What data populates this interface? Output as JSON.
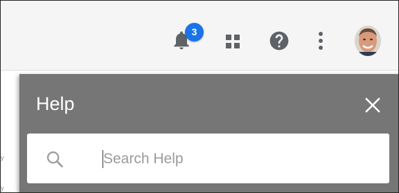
{
  "header": {
    "notifications": {
      "icon": "bell-icon",
      "count": "3",
      "badge_color": "#1a73e8"
    },
    "apps_icon": "grid-apps-icon",
    "help_icon": "help-circle-icon",
    "more_icon": "more-vertical-icon",
    "avatar": "user-avatar"
  },
  "help_panel": {
    "title": "Help",
    "close_icon": "close-icon",
    "search": {
      "icon": "search-icon",
      "placeholder": "Search Help",
      "value": ""
    },
    "background_color": "#767676"
  },
  "background": {
    "left_edge_text_1": "y",
    "left_edge_text_2": "y"
  }
}
